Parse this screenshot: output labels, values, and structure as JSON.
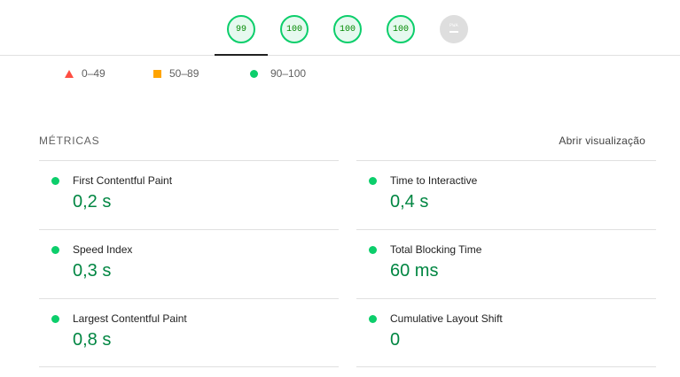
{
  "gauges": [
    {
      "label": "99",
      "category": "performance"
    },
    {
      "label": "100",
      "category": "accessibility"
    },
    {
      "label": "100",
      "category": "best-practices"
    },
    {
      "label": "100",
      "category": "seo"
    },
    {
      "label": "PWA",
      "category": "pwa"
    }
  ],
  "legend": {
    "fail": "0–49",
    "average": "50–89",
    "pass": "90–100"
  },
  "metrics": {
    "title": "MÉTRICAS",
    "toggle_label": "Abrir visualização",
    "items": [
      {
        "title": "First Contentful Paint",
        "value": "0,2 s"
      },
      {
        "title": "Time to Interactive",
        "value": "0,4 s"
      },
      {
        "title": "Speed Index",
        "value": "0,3 s"
      },
      {
        "title": "Total Blocking Time",
        "value": "60 ms"
      },
      {
        "title": "Largest Contentful Paint",
        "value": "0,8 s"
      },
      {
        "title": "Cumulative Layout Shift",
        "value": "0"
      }
    ]
  },
  "colors": {
    "pass": "#0cce6b",
    "average": "#ffa400",
    "fail": "#ff4e42",
    "pass_text": "#018642"
  }
}
